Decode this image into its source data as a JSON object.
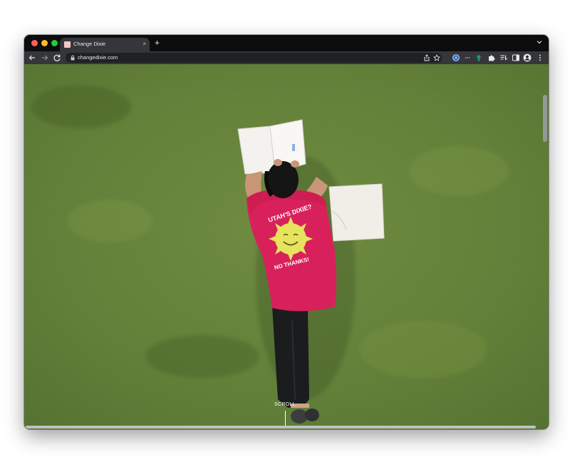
{
  "browser": {
    "tab": {
      "title": "Change Dixie",
      "close_icon": "×"
    },
    "new_tab_icon": "+",
    "address_bar": {
      "url": "changedixie.com"
    }
  },
  "hero": {
    "shirt_text_top": "UTAH'S DIXIE?",
    "shirt_text_bottom": "NO THANKS!",
    "scroll_label": "SCROLL"
  },
  "colors": {
    "grass": "#5f7d33",
    "shirt": "#d8215a",
    "sun": "#e6e35c",
    "chrome_dark": "#202124",
    "chrome_toolbar": "#35363a"
  },
  "icons": [
    "back-arrow-icon",
    "forward-arrow-icon",
    "reload-icon",
    "lock-icon",
    "share-icon",
    "star-icon",
    "extension-icon",
    "puzzle-icon",
    "reading-list-icon",
    "sidebar-icon",
    "profile-icon",
    "more-menu-icon",
    "chevron-down-icon"
  ]
}
